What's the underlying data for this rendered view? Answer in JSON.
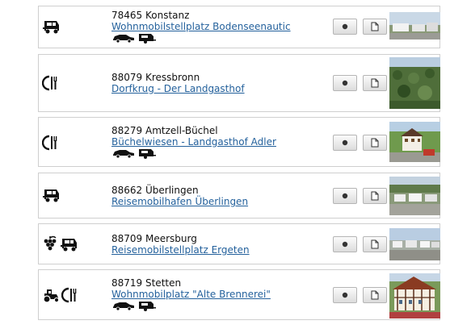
{
  "listings": [
    {
      "place": "78465 Konstanz",
      "name": "Wohnmobilstellplatz Bodenseenautic",
      "icons": [
        "camper-icon"
      ],
      "vehicles": [
        "car-icon",
        "caravan-icon"
      ]
    },
    {
      "place": "88079 Kressbronn",
      "name": "Dorfkrug - Der Landgasthof",
      "icons": [
        "restaurant-icon"
      ],
      "vehicles": []
    },
    {
      "place": "88279 Amtzell-Büchel",
      "name": "Büchelwiesen - Landgasthof Adler",
      "icons": [
        "restaurant-icon"
      ],
      "vehicles": [
        "car-icon",
        "caravan-icon"
      ]
    },
    {
      "place": "88662 Überlingen",
      "name": "Reisemobilhafen Überlingen",
      "icons": [
        "camper-icon"
      ],
      "vehicles": []
    },
    {
      "place": "88709 Meersburg",
      "name": "Reisemobilstellplatz Ergeten",
      "icons": [
        "grapes-icon",
        "camper-icon"
      ],
      "vehicles": []
    },
    {
      "place": "88719 Stetten",
      "name": "Wohnmobilplatz \"Alte Brennerei\"",
      "icons": [
        "tractor-icon",
        "restaurant-icon"
      ],
      "vehicles": [
        "car-icon",
        "caravan-icon"
      ]
    }
  ]
}
